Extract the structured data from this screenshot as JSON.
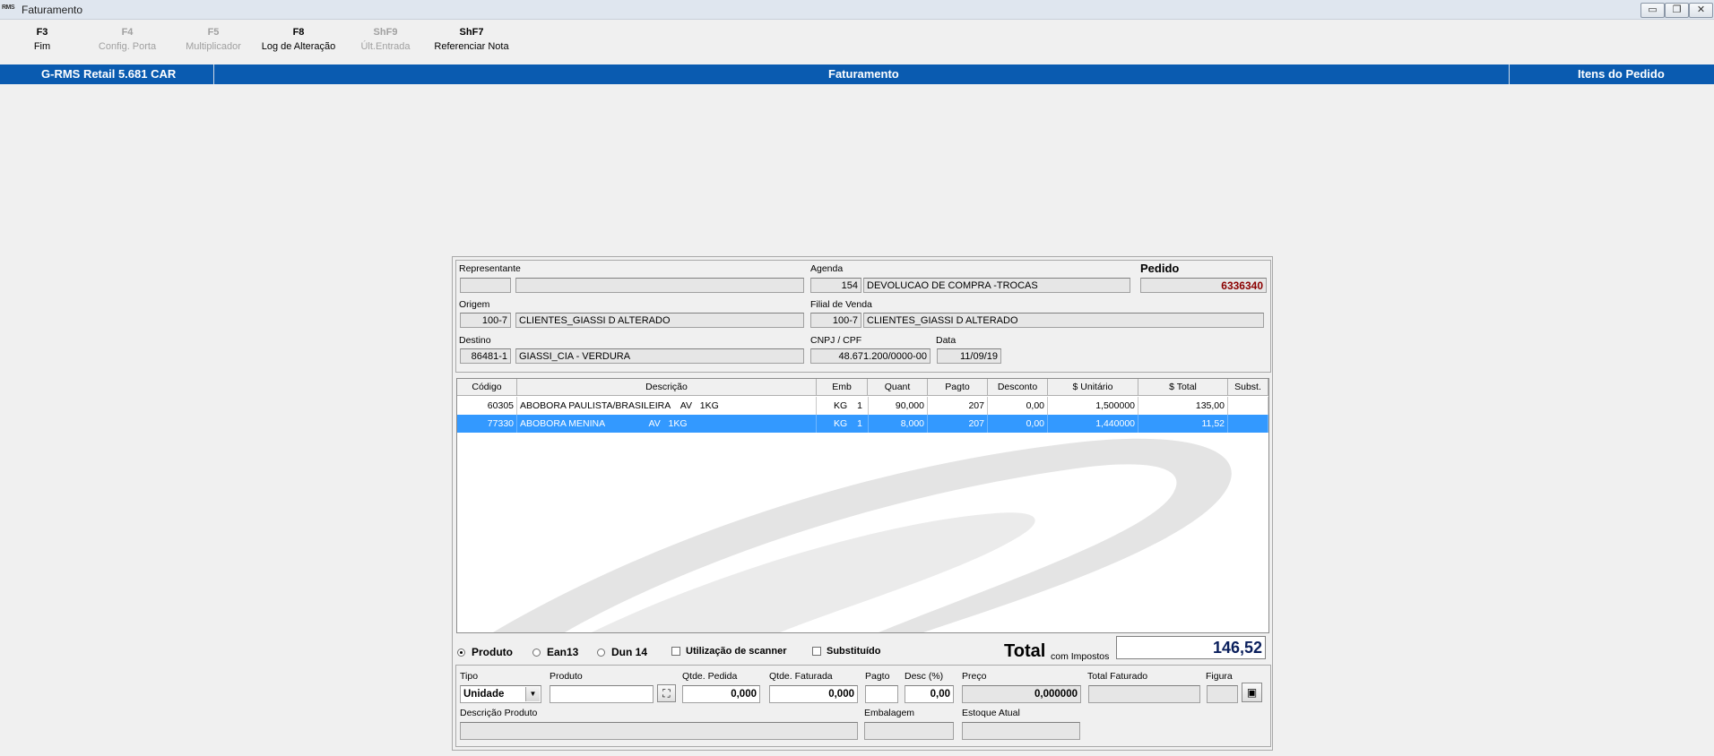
{
  "window": {
    "logo_text": "RMS",
    "title": "Faturamento",
    "minimize_glyph": "▭",
    "restore_glyph": "❐",
    "close_glyph": "✕"
  },
  "toolbar": [
    {
      "key": "F3",
      "label": "Fim",
      "enabled": true
    },
    {
      "key": "F4",
      "label": "Config. Porta",
      "enabled": false
    },
    {
      "key": "F5",
      "label": "Multiplicador",
      "enabled": false
    },
    {
      "key": "F8",
      "label": "Log de Alteração",
      "enabled": true
    },
    {
      "key": "ShF9",
      "label": "Últ.Entrada",
      "enabled": false
    },
    {
      "key": "ShF7",
      "label": "Referenciar Nota",
      "enabled": true
    }
  ],
  "header_bar": {
    "left": "G-RMS Retail 5.681 CAR",
    "center": "Faturamento",
    "right": "Itens do Pedido"
  },
  "order": {
    "representante_label": "Representante",
    "representante_code": "",
    "representante_name": "",
    "agenda_label": "Agenda",
    "agenda_code": "154",
    "agenda_desc": "DEVOLUCAO DE COMPRA -TROCAS",
    "pedido_label": "Pedido",
    "pedido_number": "6336340",
    "origem_label": "Origem",
    "origem_code": "100-7",
    "origem_name": "CLIENTES_GIASSI D ALTERADO",
    "filial_label": "Filial de Venda",
    "filial_code": "100-7",
    "filial_name": "CLIENTES_GIASSI D ALTERADO",
    "destino_label": "Destino",
    "destino_code": "86481-1",
    "destino_name": "GIASSI_CIA - VERDURA",
    "cnpj_label": "CNPJ / CPF",
    "cnpj": "48.671.200/0000-00",
    "data_label": "Data",
    "data": "11/09/19"
  },
  "grid": {
    "columns": [
      "Código",
      "Descrição",
      "Emb",
      "Quant",
      "Pagto",
      "Desconto",
      "$ Unitário",
      "$ Total",
      "Subst."
    ],
    "rows": [
      {
        "codigo": "60305",
        "descricao": "ABOBORA PAULISTA/BRASILEIRA    AV   1KG",
        "emb": "KG",
        "emb_qtd": "1",
        "quant": "90,000",
        "pagto": "207",
        "desconto": "0,00",
        "unitario": "1,500000",
        "total": "135,00",
        "subst": "",
        "selected": false
      },
      {
        "codigo": "77330",
        "descricao": "ABOBORA MENINA                 AV   1KG",
        "emb": "KG",
        "emb_qtd": "1",
        "quant": "8,000",
        "pagto": "207",
        "desconto": "0,00",
        "unitario": "1,440000",
        "total": "11,52",
        "subst": "",
        "selected": true
      }
    ]
  },
  "search_mode": {
    "options": [
      "Produto",
      "Ean13",
      "Dun 14"
    ],
    "selected": "Produto",
    "scanner_label": "Utilização de scanner",
    "substituido_label": "Substituído"
  },
  "totals": {
    "total_label": "Total",
    "total_suffix": "com Impostos",
    "total_value": "146,52"
  },
  "entry": {
    "tipo_label": "Tipo",
    "tipo_value": "Unidade",
    "produto_label": "Produto",
    "produto_value": "",
    "qtde_pedida_label": "Qtde. Pedida",
    "qtde_pedida_value": "0,000",
    "qtde_faturada_label": "Qtde. Faturada",
    "qtde_faturada_value": "0,000",
    "pagto_label": "Pagto",
    "pagto_value": "",
    "desc_label": "Desc (%)",
    "desc_value": "0,00",
    "preco_label": "Preço",
    "preco_value": "0,000000",
    "total_faturado_label": "Total Faturado",
    "total_faturado_value": "",
    "figura_label": "Figura",
    "descricao_produto_label": "Descrição Produto",
    "descricao_produto_value": "",
    "embalagem_label": "Embalagem",
    "embalagem_value": "",
    "estoque_label": "Estoque Atual",
    "estoque_value": ""
  },
  "colors": {
    "header_blue": "#0a5bb0",
    "selection": "#3399ff",
    "pedido_red": "#8b0000",
    "total_navy": "#0a1f5c"
  }
}
